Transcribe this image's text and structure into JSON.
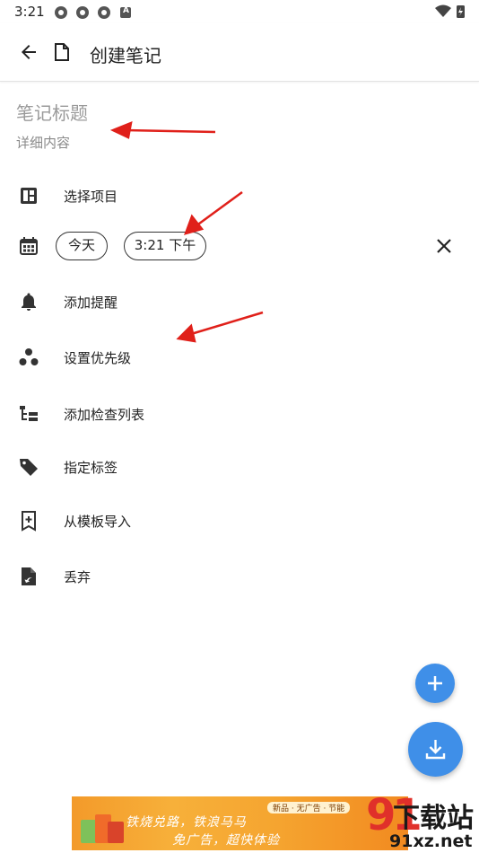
{
  "status_bar": {
    "time": "3:21",
    "notif_badge": "A"
  },
  "appbar": {
    "title": "创建笔记",
    "back_icon": "arrow-left-icon",
    "doc_icon": "document-icon"
  },
  "note": {
    "title_placeholder": "笔记标题",
    "detail_placeholder": "详细内容"
  },
  "menu": [
    {
      "id": "select-project",
      "label": "选择项目",
      "icon": "dashboard-icon"
    },
    {
      "id": "add-reminder",
      "label": "添加提醒",
      "icon": "bell-icon"
    },
    {
      "id": "set-priority",
      "label": "设置优先级",
      "icon": "priority-dots-icon"
    },
    {
      "id": "add-checklist",
      "label": "添加检查列表",
      "icon": "checklist-icon"
    },
    {
      "id": "assign-tag",
      "label": "指定标签",
      "icon": "tag-icon"
    },
    {
      "id": "import-template",
      "label": "从模板导入",
      "icon": "bookmark-add-icon"
    },
    {
      "id": "discard",
      "label": "丢弃",
      "icon": "discard-file-icon"
    }
  ],
  "schedule": {
    "date_chip": "今天",
    "time_chip": "3:21 下午",
    "icon": "calendar-icon",
    "clear_icon": "close-icon"
  },
  "fabs": {
    "add_icon": "plus-icon",
    "save_icon": "download-icon"
  },
  "ad": {
    "line1": "铁烧兑路，铁浪马马",
    "line2": "免广告，超快体验",
    "mini_label": "新品 · 无广告 · 节能"
  },
  "watermark": {
    "number": "91",
    "text": "下载站",
    "domain": "91xz.net"
  },
  "colors": {
    "accent": "#3f8fe8",
    "annotation_arrow": "#e0201a",
    "ad_orange": "#f5a530"
  }
}
